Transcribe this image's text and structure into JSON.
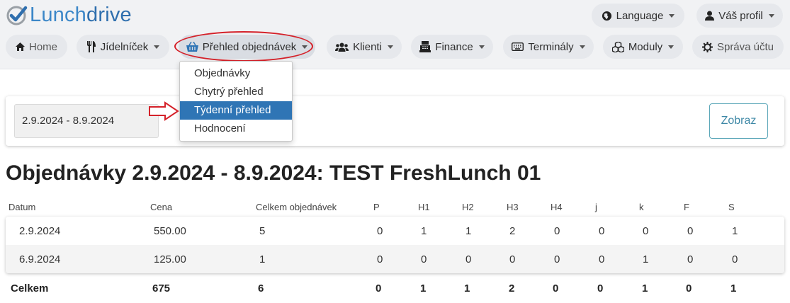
{
  "logo": {
    "part1": "Lunch",
    "part2": "drive"
  },
  "top_right": {
    "language": "Language",
    "profile": "Váš profil"
  },
  "nav": {
    "home": "Home",
    "menu": "Jídelníček",
    "orders": "Přehled objednávek",
    "clients": "Klienti",
    "finance": "Finance",
    "terminals": "Terminály",
    "modules": "Moduly",
    "account": "Správa účtu"
  },
  "dropdown": {
    "items": [
      "Objednávky",
      "Chytrý přehled",
      "Týdenní přehled",
      "Hodnocení"
    ],
    "selected_index": 2
  },
  "filter": {
    "date_range": "2.9.2024 - 8.9.2024",
    "show_button": "Zobraz"
  },
  "page_title": "Objednávky 2.9.2024 - 8.9.2024: TEST FreshLunch 01",
  "table": {
    "headers": [
      "Datum",
      "Cena",
      "Celkem objednávek",
      "P",
      "H1",
      "H2",
      "H3",
      "H4",
      "j",
      "k",
      "F",
      "S"
    ],
    "rows": [
      [
        "2.9.2024",
        "550.00",
        "5",
        "0",
        "1",
        "1",
        "2",
        "0",
        "0",
        "0",
        "0",
        "1"
      ],
      [
        "6.9.2024",
        "125.00",
        "1",
        "0",
        "0",
        "0",
        "0",
        "0",
        "0",
        "1",
        "0",
        "0"
      ]
    ],
    "total": [
      "Celkem",
      "675",
      "6",
      "0",
      "1",
      "1",
      "2",
      "0",
      "0",
      "1",
      "0",
      "1"
    ]
  },
  "colors": {
    "accent": "#2f75b5",
    "highlight_red": "#d5222a",
    "button_border": "#5aa6b8"
  }
}
